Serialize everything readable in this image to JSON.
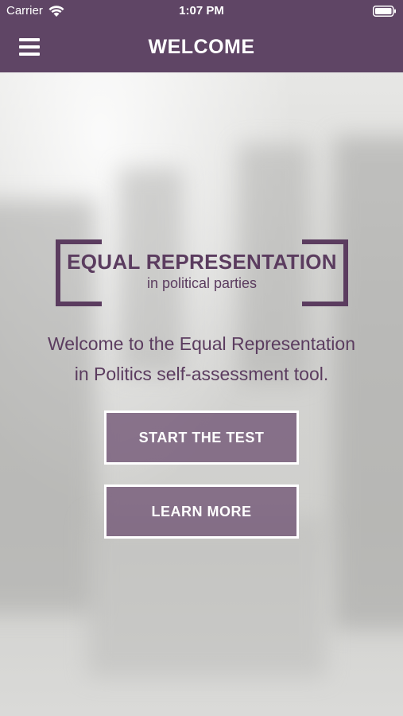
{
  "status_bar": {
    "carrier": "Carrier",
    "time": "1:07 PM"
  },
  "header": {
    "title": "WELCOME",
    "background_color": "#5f4565"
  },
  "logo": {
    "title": "EQUAL REPRESENTATION",
    "subtitle": "in political parties",
    "color": "#5b3c5f"
  },
  "intro": {
    "line1": "Welcome to the Equal Representation",
    "line2": "in Politics self-assessment tool."
  },
  "actions": {
    "start_label": "START THE TEST",
    "learn_label": "LEARN MORE"
  },
  "icons": {
    "menu": "hamburger-menu-icon",
    "wifi": "wifi-icon",
    "battery": "battery-icon"
  }
}
